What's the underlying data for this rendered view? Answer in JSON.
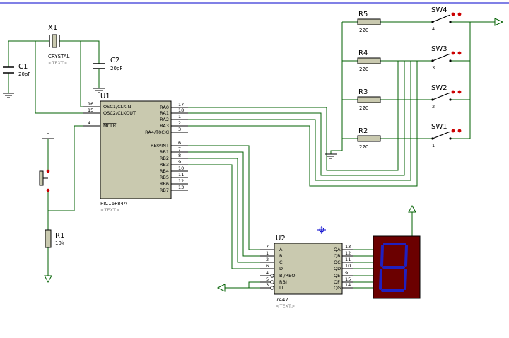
{
  "colors": {
    "wire": "#006000",
    "wire_dark": "#004000",
    "chip_fill": "#c9c9af",
    "resistor_fill": "#c9c9af",
    "display_bg": "#6b0000",
    "segment": "#2020c0",
    "led_red": "#cc0000",
    "text_gray": "#888888",
    "marker": "#0000cc"
  },
  "crystal": {
    "ref": "X1",
    "name": "CRYSTAL",
    "text": "<TEXT>"
  },
  "caps": [
    {
      "ref": "C1",
      "value": "20pF"
    },
    {
      "ref": "C2",
      "value": "20pF"
    }
  ],
  "reset_resistor": {
    "ref": "R1",
    "value": "10k"
  },
  "mcu": {
    "ref": "U1",
    "name": "PIC16F84A",
    "text": "<TEXT>",
    "left_pins": [
      {
        "num": "16",
        "label": "OSC1/CLKIN"
      },
      {
        "num": "15",
        "label": "OSC2/CLKOUT"
      },
      {
        "num": "4",
        "label": "MCLR"
      }
    ],
    "right_pins": [
      {
        "num": "17",
        "label": "RA0"
      },
      {
        "num": "18",
        "label": "RA1"
      },
      {
        "num": "1",
        "label": "RA2"
      },
      {
        "num": "2",
        "label": "RA3"
      },
      {
        "num": "3",
        "label": "RA4/T0CKI"
      },
      {
        "num": "6",
        "label": "RB0/INT"
      },
      {
        "num": "7",
        "label": "RB1"
      },
      {
        "num": "8",
        "label": "RB2"
      },
      {
        "num": "9",
        "label": "RB3"
      },
      {
        "num": "10",
        "label": "RB4"
      },
      {
        "num": "11",
        "label": "RB5"
      },
      {
        "num": "12",
        "label": "RB6"
      },
      {
        "num": "13",
        "label": "RB7"
      }
    ]
  },
  "decoder": {
    "ref": "U2",
    "name": "7447",
    "text": "<TEXT>",
    "left_pins": [
      {
        "num": "7",
        "label": "A"
      },
      {
        "num": "1",
        "label": "B"
      },
      {
        "num": "2",
        "label": "C"
      },
      {
        "num": "6",
        "label": "D"
      },
      {
        "num": "4",
        "label": "BI/RBO"
      },
      {
        "num": "5",
        "label": "RBI"
      },
      {
        "num": "3",
        "label": "LT"
      }
    ],
    "right_pins": [
      {
        "num": "13",
        "label": "QA"
      },
      {
        "num": "12",
        "label": "QB"
      },
      {
        "num": "11",
        "label": "QC"
      },
      {
        "num": "10",
        "label": "QD"
      },
      {
        "num": "9",
        "label": "QE"
      },
      {
        "num": "15",
        "label": "QF"
      },
      {
        "num": "14",
        "label": "QG"
      }
    ]
  },
  "pullups": [
    {
      "ref": "R5",
      "value": "220"
    },
    {
      "ref": "R4",
      "value": "220"
    },
    {
      "ref": "R3",
      "value": "220"
    },
    {
      "ref": "R2",
      "value": "220"
    }
  ],
  "switches": [
    {
      "ref": "SW4",
      "pin": "4"
    },
    {
      "ref": "SW3",
      "pin": "3"
    },
    {
      "ref": "SW2",
      "pin": "2"
    },
    {
      "ref": "SW1",
      "pin": "1"
    }
  ],
  "display": {
    "digit": "8"
  }
}
